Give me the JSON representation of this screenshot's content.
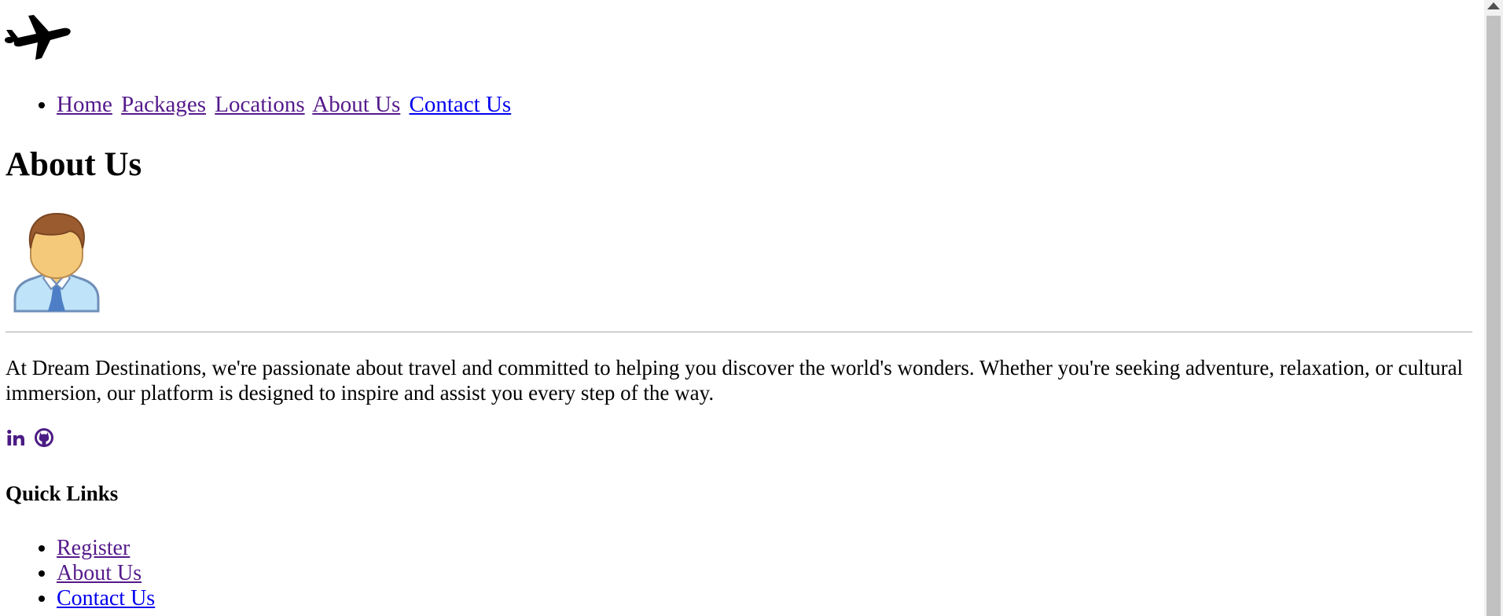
{
  "nav": {
    "items": [
      {
        "label": "Home"
      },
      {
        "label": "Packages"
      },
      {
        "label": "Locations"
      },
      {
        "label": "About Us"
      },
      {
        "label": "Contact Us"
      }
    ]
  },
  "main": {
    "title": "About Us",
    "description": "At Dream Destinations, we're passionate about travel and committed to helping you discover the world's wonders. Whether you're seeking adventure, relaxation, or cultural immersion, our platform is designed to inspire and assist you every step of the way."
  },
  "social": {
    "icons": [
      "linkedin-icon",
      "github-icon"
    ],
    "color": "#4b1c84"
  },
  "quick_links": {
    "title": "Quick Links",
    "items": [
      {
        "label": "Register"
      },
      {
        "label": "About Us"
      },
      {
        "label": "Contact Us"
      }
    ]
  },
  "colors": {
    "link": "#0000ee",
    "visited_link": "#551a8b"
  }
}
